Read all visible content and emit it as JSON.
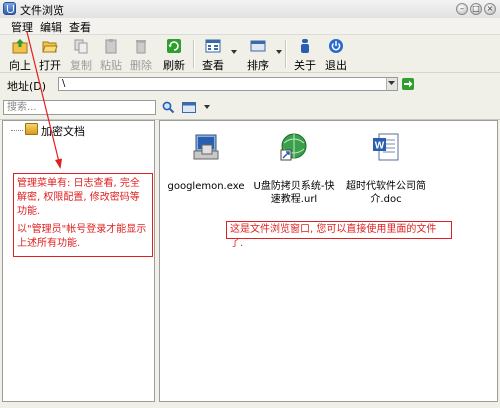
{
  "window": {
    "title": "文件浏览"
  },
  "menu": [
    "管理",
    "编辑",
    "查看"
  ],
  "toolbar": {
    "up": "向上",
    "open": "打开",
    "copy": "复制",
    "paste": "粘贴",
    "delete": "删除",
    "refresh": "刷新",
    "view": "查看",
    "sort": "排序",
    "about": "关于",
    "exit": "退出"
  },
  "address": {
    "label": "地址(D)",
    "value": "\\"
  },
  "search": {
    "placeholder": "搜索..."
  },
  "tree": {
    "root": "加密文档"
  },
  "files": [
    {
      "name": "googlemon.exe",
      "icon": "exe-icon"
    },
    {
      "name": "U盘防拷贝系统-快速教程.url",
      "icon": "url-icon"
    },
    {
      "name": "超时代软件公司简介.doc",
      "icon": "doc-icon"
    }
  ],
  "annotations": {
    "left": "管理菜单有: 日志查看, 完全解密, 权限配置, 修改密码等功能.",
    "left2": "以\"管理员\"帐号登录才能显示上述所有功能.",
    "right": "这是文件浏览窗口, 您可以直接使用里面的文件了."
  },
  "colors": {
    "annotation": "#e02020",
    "toolbar_bg": "#f0efe8"
  }
}
